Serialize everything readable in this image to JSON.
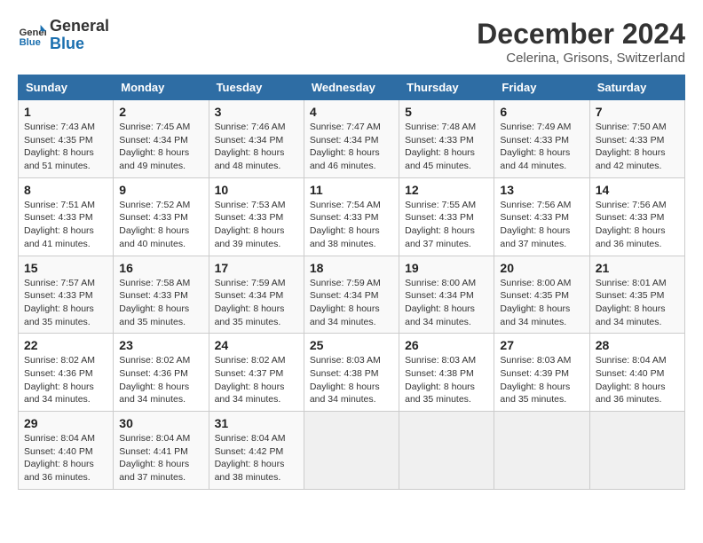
{
  "header": {
    "logo_line1": "General",
    "logo_line2": "Blue",
    "month_year": "December 2024",
    "location": "Celerina, Grisons, Switzerland"
  },
  "days_of_week": [
    "Sunday",
    "Monday",
    "Tuesday",
    "Wednesday",
    "Thursday",
    "Friday",
    "Saturday"
  ],
  "weeks": [
    [
      {
        "num": "1",
        "sunrise": "7:43 AM",
        "sunset": "4:35 PM",
        "daylight": "8 hours and 51 minutes."
      },
      {
        "num": "2",
        "sunrise": "7:45 AM",
        "sunset": "4:34 PM",
        "daylight": "8 hours and 49 minutes."
      },
      {
        "num": "3",
        "sunrise": "7:46 AM",
        "sunset": "4:34 PM",
        "daylight": "8 hours and 48 minutes."
      },
      {
        "num": "4",
        "sunrise": "7:47 AM",
        "sunset": "4:34 PM",
        "daylight": "8 hours and 46 minutes."
      },
      {
        "num": "5",
        "sunrise": "7:48 AM",
        "sunset": "4:33 PM",
        "daylight": "8 hours and 45 minutes."
      },
      {
        "num": "6",
        "sunrise": "7:49 AM",
        "sunset": "4:33 PM",
        "daylight": "8 hours and 44 minutes."
      },
      {
        "num": "7",
        "sunrise": "7:50 AM",
        "sunset": "4:33 PM",
        "daylight": "8 hours and 42 minutes."
      }
    ],
    [
      {
        "num": "8",
        "sunrise": "7:51 AM",
        "sunset": "4:33 PM",
        "daylight": "8 hours and 41 minutes."
      },
      {
        "num": "9",
        "sunrise": "7:52 AM",
        "sunset": "4:33 PM",
        "daylight": "8 hours and 40 minutes."
      },
      {
        "num": "10",
        "sunrise": "7:53 AM",
        "sunset": "4:33 PM",
        "daylight": "8 hours and 39 minutes."
      },
      {
        "num": "11",
        "sunrise": "7:54 AM",
        "sunset": "4:33 PM",
        "daylight": "8 hours and 38 minutes."
      },
      {
        "num": "12",
        "sunrise": "7:55 AM",
        "sunset": "4:33 PM",
        "daylight": "8 hours and 37 minutes."
      },
      {
        "num": "13",
        "sunrise": "7:56 AM",
        "sunset": "4:33 PM",
        "daylight": "8 hours and 37 minutes."
      },
      {
        "num": "14",
        "sunrise": "7:56 AM",
        "sunset": "4:33 PM",
        "daylight": "8 hours and 36 minutes."
      }
    ],
    [
      {
        "num": "15",
        "sunrise": "7:57 AM",
        "sunset": "4:33 PM",
        "daylight": "8 hours and 35 minutes."
      },
      {
        "num": "16",
        "sunrise": "7:58 AM",
        "sunset": "4:33 PM",
        "daylight": "8 hours and 35 minutes."
      },
      {
        "num": "17",
        "sunrise": "7:59 AM",
        "sunset": "4:34 PM",
        "daylight": "8 hours and 35 minutes."
      },
      {
        "num": "18",
        "sunrise": "7:59 AM",
        "sunset": "4:34 PM",
        "daylight": "8 hours and 34 minutes."
      },
      {
        "num": "19",
        "sunrise": "8:00 AM",
        "sunset": "4:34 PM",
        "daylight": "8 hours and 34 minutes."
      },
      {
        "num": "20",
        "sunrise": "8:00 AM",
        "sunset": "4:35 PM",
        "daylight": "8 hours and 34 minutes."
      },
      {
        "num": "21",
        "sunrise": "8:01 AM",
        "sunset": "4:35 PM",
        "daylight": "8 hours and 34 minutes."
      }
    ],
    [
      {
        "num": "22",
        "sunrise": "8:02 AM",
        "sunset": "4:36 PM",
        "daylight": "8 hours and 34 minutes."
      },
      {
        "num": "23",
        "sunrise": "8:02 AM",
        "sunset": "4:36 PM",
        "daylight": "8 hours and 34 minutes."
      },
      {
        "num": "24",
        "sunrise": "8:02 AM",
        "sunset": "4:37 PM",
        "daylight": "8 hours and 34 minutes."
      },
      {
        "num": "25",
        "sunrise": "8:03 AM",
        "sunset": "4:38 PM",
        "daylight": "8 hours and 34 minutes."
      },
      {
        "num": "26",
        "sunrise": "8:03 AM",
        "sunset": "4:38 PM",
        "daylight": "8 hours and 35 minutes."
      },
      {
        "num": "27",
        "sunrise": "8:03 AM",
        "sunset": "4:39 PM",
        "daylight": "8 hours and 35 minutes."
      },
      {
        "num": "28",
        "sunrise": "8:04 AM",
        "sunset": "4:40 PM",
        "daylight": "8 hours and 36 minutes."
      }
    ],
    [
      {
        "num": "29",
        "sunrise": "8:04 AM",
        "sunset": "4:40 PM",
        "daylight": "8 hours and 36 minutes."
      },
      {
        "num": "30",
        "sunrise": "8:04 AM",
        "sunset": "4:41 PM",
        "daylight": "8 hours and 37 minutes."
      },
      {
        "num": "31",
        "sunrise": "8:04 AM",
        "sunset": "4:42 PM",
        "daylight": "8 hours and 38 minutes."
      },
      null,
      null,
      null,
      null
    ]
  ]
}
